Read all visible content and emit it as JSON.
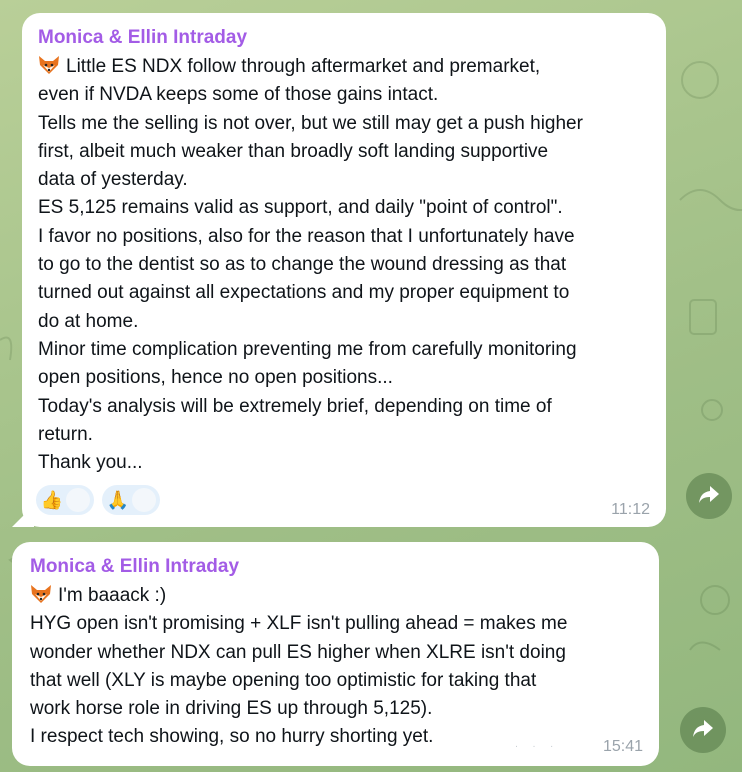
{
  "chat": {
    "messages": [
      {
        "sender": "Monica & Ellin Intraday",
        "lines": [
          "Little ES NDX follow through aftermarket and premarket,",
          "even if NVDA keeps some of those gains intact.",
          "Tells me the selling is not over, but we still may get a push higher",
          "first, albeit much weaker than broadly soft landing supportive",
          "data of yesterday.",
          "ES 5,125 remains valid as support, and daily \"point of control\".",
          "I favor no positions, also for the reason that I unfortunately have",
          "to go to the dentist so as to change the wound dressing as that",
          "turned out against all expectations and my proper equipment to",
          "do at home.",
          "Minor time complication preventing me from carefully monitoring",
          "open positions, hence no open positions...",
          "Today's analysis will be extremely brief, depending on time of",
          "return.",
          "Thank you..."
        ],
        "reactions": [
          {
            "emoji": "👍",
            "icon": "thumbs-up-icon"
          },
          {
            "emoji": "🙏",
            "icon": "praying-hands-icon"
          }
        ],
        "time": "11:12"
      },
      {
        "sender": "Monica & Ellin Intraday",
        "lines": [
          "I'm baaack :)",
          "HYG open isn't promising + XLF isn't pulling ahead = makes me",
          "wonder whether NDX can pull ES higher when XLRE isn't doing",
          "that well (XLY is maybe opening too optimistic for taking that",
          "work horse role in driving ES up through 5,125).",
          "I respect tech showing, so no hurry shorting yet."
        ],
        "time": "15:41"
      }
    ]
  },
  "colors": {
    "sender": "#a35ce6",
    "time": "#9aa3ab",
    "bubble": "#ffffff",
    "wallpaper": "#a9c58d"
  },
  "icons": {
    "emoji": "fox-emoji-icon",
    "forward": "forward-arrow-icon"
  }
}
